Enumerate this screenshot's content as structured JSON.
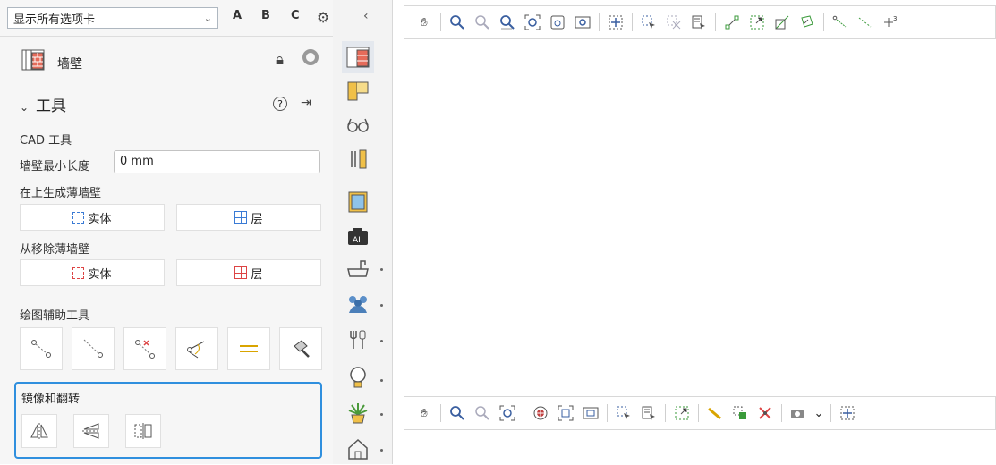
{
  "tab_selector": {
    "value": "显示所有选项卡"
  },
  "top_letters": [
    "A",
    "B",
    "C"
  ],
  "header": {
    "title": "墙壁"
  },
  "tools": {
    "section_title": "工具",
    "cad_title": "CAD 工具",
    "min_length_label": "墙壁最小长度",
    "min_length_value": "0 mm",
    "generate_label": "在上生成薄墙壁",
    "remove_label": "从移除薄墙壁",
    "solid_label": "实体",
    "layer_label": "层",
    "drawing_aids_label": "绘图辅助工具",
    "mirror_label": "镜像和翻转"
  },
  "colors": {
    "accent": "#2f8fde",
    "remove": "#d44444",
    "generate": "#3a7bd5"
  },
  "strip_icons": [
    "wall-icon",
    "door-icon",
    "glasses-icon",
    "tools-icon",
    "picture-frame-icon",
    "ai-camera-icon",
    "bathtub-icon",
    "people-icon",
    "kitchen-tools-icon",
    "light-bulb-icon",
    "plant-icon",
    "home-icon"
  ]
}
